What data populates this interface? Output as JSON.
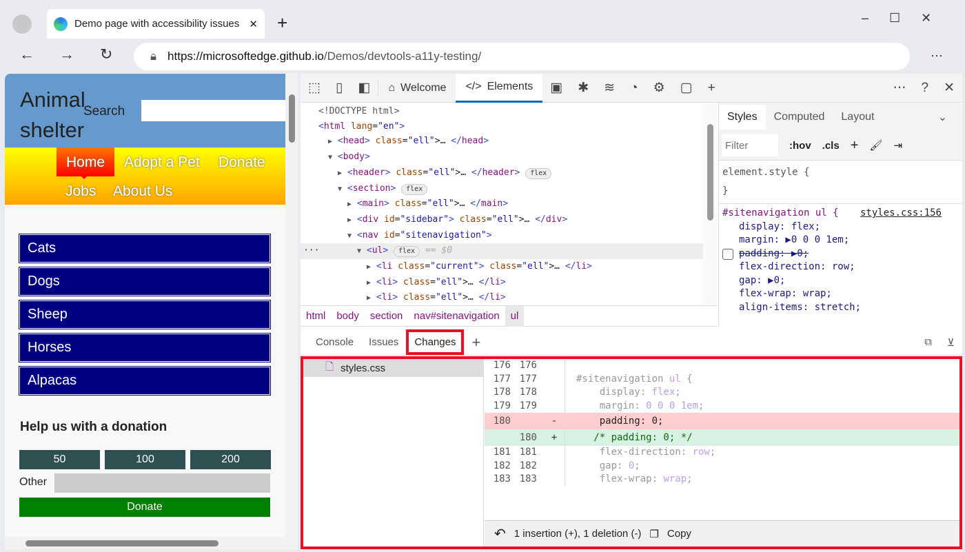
{
  "browser": {
    "tab_title": "Demo page with accessibility issues",
    "url_host": "https://microsoftedge.github.io",
    "url_path": "/Demos/devtools-a11y-testing/",
    "new_tab": "+",
    "menu": "···"
  },
  "page": {
    "logo_line1": "Animal",
    "logo_line2": "shelter",
    "search_label": "Search",
    "nav": [
      "Home",
      "Adopt a Pet",
      "Donate",
      "Jobs",
      "About Us"
    ],
    "animals": [
      "Cats",
      "Dogs",
      "Sheep",
      "Horses",
      "Alpacas"
    ],
    "donation_heading": "Help us with a donation",
    "amounts": [
      "50",
      "100",
      "200"
    ],
    "other_label": "Other",
    "donate_button": "Donate"
  },
  "devtools": {
    "tabs": [
      "Welcome",
      "Elements"
    ],
    "active_tab": "Elements",
    "tree": [
      {
        "indent": 0,
        "text": "<!DOCTYPE html>"
      },
      {
        "indent": 0,
        "text": "<html lang=\"en\">"
      },
      {
        "indent": 1,
        "arrow": "▶",
        "text": "<head> … </head>"
      },
      {
        "indent": 1,
        "arrow": "▼",
        "text": "<body>"
      },
      {
        "indent": 2,
        "arrow": "▶",
        "text": "<header> … </header>",
        "badge": "flex"
      },
      {
        "indent": 2,
        "arrow": "▼",
        "text": "<section>",
        "badge": "flex"
      },
      {
        "indent": 3,
        "arrow": "▶",
        "text": "<main> … </main>"
      },
      {
        "indent": 3,
        "arrow": "▶",
        "text": "<div id=\"sidebar\"> … </div>"
      },
      {
        "indent": 3,
        "arrow": "▼",
        "text": "<nav id=\"sitenavigation\">"
      },
      {
        "indent": 4,
        "arrow": "▼",
        "text": "<ul>",
        "badge": "flex",
        "suffix": "== $0",
        "selected": true
      },
      {
        "indent": 5,
        "arrow": "▶",
        "text": "<li class=\"current\"> … </li>"
      },
      {
        "indent": 5,
        "arrow": "▶",
        "text": "<li> … </li>"
      },
      {
        "indent": 5,
        "arrow": "▶",
        "text": "<li> … </li>"
      },
      {
        "indent": 5,
        "arrow": "▶",
        "text": "<li> … </li>"
      }
    ],
    "breadcrumb": [
      "html",
      "body",
      "section",
      "nav#sitenavigation",
      "ul"
    ],
    "styles": {
      "tabs": [
        "Styles",
        "Computed",
        "Layout"
      ],
      "filter_placeholder": "Filter",
      "hov": ":hov",
      "cls": ".cls",
      "element_style": "element.style {",
      "close": "}",
      "rule_selector": "#sitenavigation ul {",
      "rule_source": "styles.css:156",
      "props": [
        {
          "text": "display: flex;"
        },
        {
          "text": "margin: ▶0 0 0 1em;"
        },
        {
          "text": "padding: ▶0;",
          "disabled": true
        },
        {
          "text": "flex-direction: row;"
        },
        {
          "text": "gap: ▶0;"
        },
        {
          "text": "flex-wrap: wrap;"
        },
        {
          "text": "align-items: stretch;"
        }
      ]
    },
    "drawer_tabs": [
      "Console",
      "Issues",
      "Changes"
    ],
    "active_drawer": "Changes",
    "changes": {
      "file": "styles.css",
      "lines": [
        {
          "old": "176",
          "new": "176",
          "mark": "",
          "code": ""
        },
        {
          "old": "177",
          "new": "177",
          "mark": "",
          "code": "#sitenavigation ul {"
        },
        {
          "old": "178",
          "new": "178",
          "mark": "",
          "code": "    display: flex;"
        },
        {
          "old": "179",
          "new": "179",
          "mark": "",
          "code": "    margin: 0 0 0 1em;"
        },
        {
          "old": "180",
          "new": "",
          "mark": "-",
          "code": "    padding: 0;",
          "type": "del"
        },
        {
          "old": "",
          "new": "180",
          "mark": "+",
          "code": "   /* padding: 0; */",
          "type": "add"
        },
        {
          "old": "181",
          "new": "181",
          "mark": "",
          "code": "    flex-direction: row;"
        },
        {
          "old": "182",
          "new": "182",
          "mark": "",
          "code": "    gap: 0;"
        },
        {
          "old": "183",
          "new": "183",
          "mark": "",
          "code": "    flex-wrap: wrap;"
        }
      ],
      "summary": "1 insertion (+), 1 deletion (-)",
      "copy": "Copy"
    },
    "colors": {
      "highlight": "#e81123",
      "del_bg": "#ffcdcd",
      "add_bg": "#d7f2e2",
      "accent": "#0f6cbd"
    }
  }
}
